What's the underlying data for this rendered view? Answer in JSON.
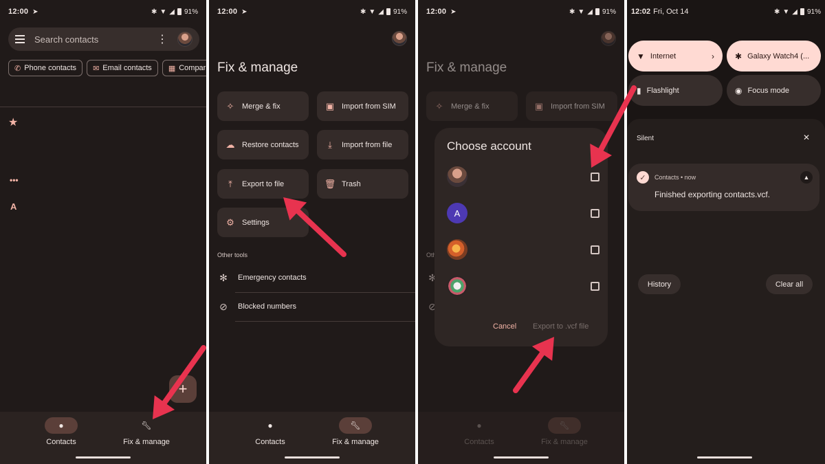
{
  "colors": {
    "arrow": "#e8334f",
    "accent": "#f2b3a6",
    "background": "#201a19"
  },
  "status": {
    "time": "12:00",
    "battery": "91%"
  },
  "panel1": {
    "search_placeholder": "Search contacts",
    "chips": [
      {
        "label": "Phone contacts",
        "icon": "phone-icon"
      },
      {
        "label": "Email contacts",
        "icon": "email-icon"
      },
      {
        "label": "Compar",
        "icon": "building-icon"
      }
    ],
    "section_letter": "A"
  },
  "nav": {
    "contacts": "Contacts",
    "fix_manage": "Fix & manage"
  },
  "fix_manage": {
    "title": "Fix & manage",
    "tiles": [
      {
        "label": "Merge & fix",
        "icon": "magic-wand-icon"
      },
      {
        "label": "Import from SIM",
        "icon": "sim-card-icon"
      },
      {
        "label": "Restore contacts",
        "icon": "cloud-restore-icon"
      },
      {
        "label": "Import from file",
        "icon": "download-icon"
      },
      {
        "label": "Export to file",
        "icon": "upload-icon"
      },
      {
        "label": "Trash",
        "icon": "trash-icon"
      },
      {
        "label": "Settings",
        "icon": "gear-icon"
      }
    ],
    "other_tools_label": "Other tools",
    "other_tools": [
      {
        "label": "Emergency contacts",
        "icon": "asterisk-icon"
      },
      {
        "label": "Blocked numbers",
        "icon": "block-icon"
      }
    ]
  },
  "dialog": {
    "title": "Choose account",
    "account_initial": "A",
    "cancel": "Cancel",
    "export": "Export to .vcf file"
  },
  "panel4": {
    "time": "12:02",
    "date": "Fri, Oct 14",
    "battery": "91%",
    "tiles": [
      {
        "label": "Internet",
        "icon": "wifi-icon",
        "on": true
      },
      {
        "label": "Galaxy Watch4 (...",
        "icon": "bluetooth-icon",
        "on": true
      },
      {
        "label": "Flashlight",
        "icon": "flashlight-icon",
        "on": false
      },
      {
        "label": "Focus mode",
        "icon": "focus-icon",
        "on": false
      }
    ],
    "silent": "Silent",
    "notification": {
      "app": "Contacts • now",
      "text": "Finished exporting contacts.vcf."
    },
    "history": "History",
    "clear_all": "Clear all"
  }
}
